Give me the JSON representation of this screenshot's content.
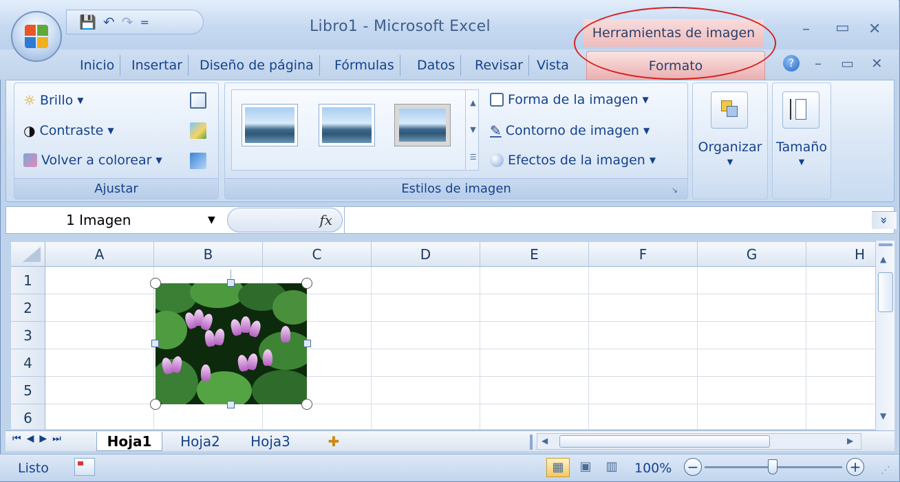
{
  "window": {
    "title": "Libro1 - Microsoft Excel",
    "contextual_group": "Herramientas de imagen",
    "min_glyph": "–",
    "restore_glyph": "▭",
    "close_glyph": "✕"
  },
  "qat": {
    "save_glyph": "💾",
    "undo_glyph": "↶",
    "redo_glyph": "↷",
    "customize_glyph": "="
  },
  "tabs": [
    "Inicio",
    "Insertar",
    "Diseño de página",
    "Fórmulas",
    "Datos",
    "Revisar",
    "Vista"
  ],
  "active_tab": "Formato",
  "ribbon": {
    "ajustar": {
      "label": "Ajustar",
      "brillo": "Brillo",
      "contraste": "Contraste",
      "volver": "Volver a colorear"
    },
    "estilos": {
      "label": "Estilos de imagen",
      "forma": "Forma de la imagen",
      "contorno": "Contorno de imagen",
      "efectos": "Efectos de la imagen"
    },
    "organizar": "Organizar",
    "tamano": "Tamaño"
  },
  "formula_bar": {
    "name_box": "1 Imagen",
    "fx_label": "fx",
    "expand_glyph": "»"
  },
  "columns": [
    "A",
    "B",
    "C",
    "D",
    "E",
    "F",
    "G",
    "H"
  ],
  "rows": [
    "1",
    "2",
    "3",
    "4",
    "5",
    "6"
  ],
  "sheets": [
    "Hoja1",
    "Hoja2",
    "Hoja3"
  ],
  "active_sheet": "Hoja1",
  "status": {
    "ready": "Listo",
    "zoom": "100%",
    "zoom_out": "−",
    "zoom_in": "+"
  },
  "colors": {
    "accent": "#15428b",
    "contextual": "#efbcbc",
    "highlight_ellipse": "#d62020"
  }
}
